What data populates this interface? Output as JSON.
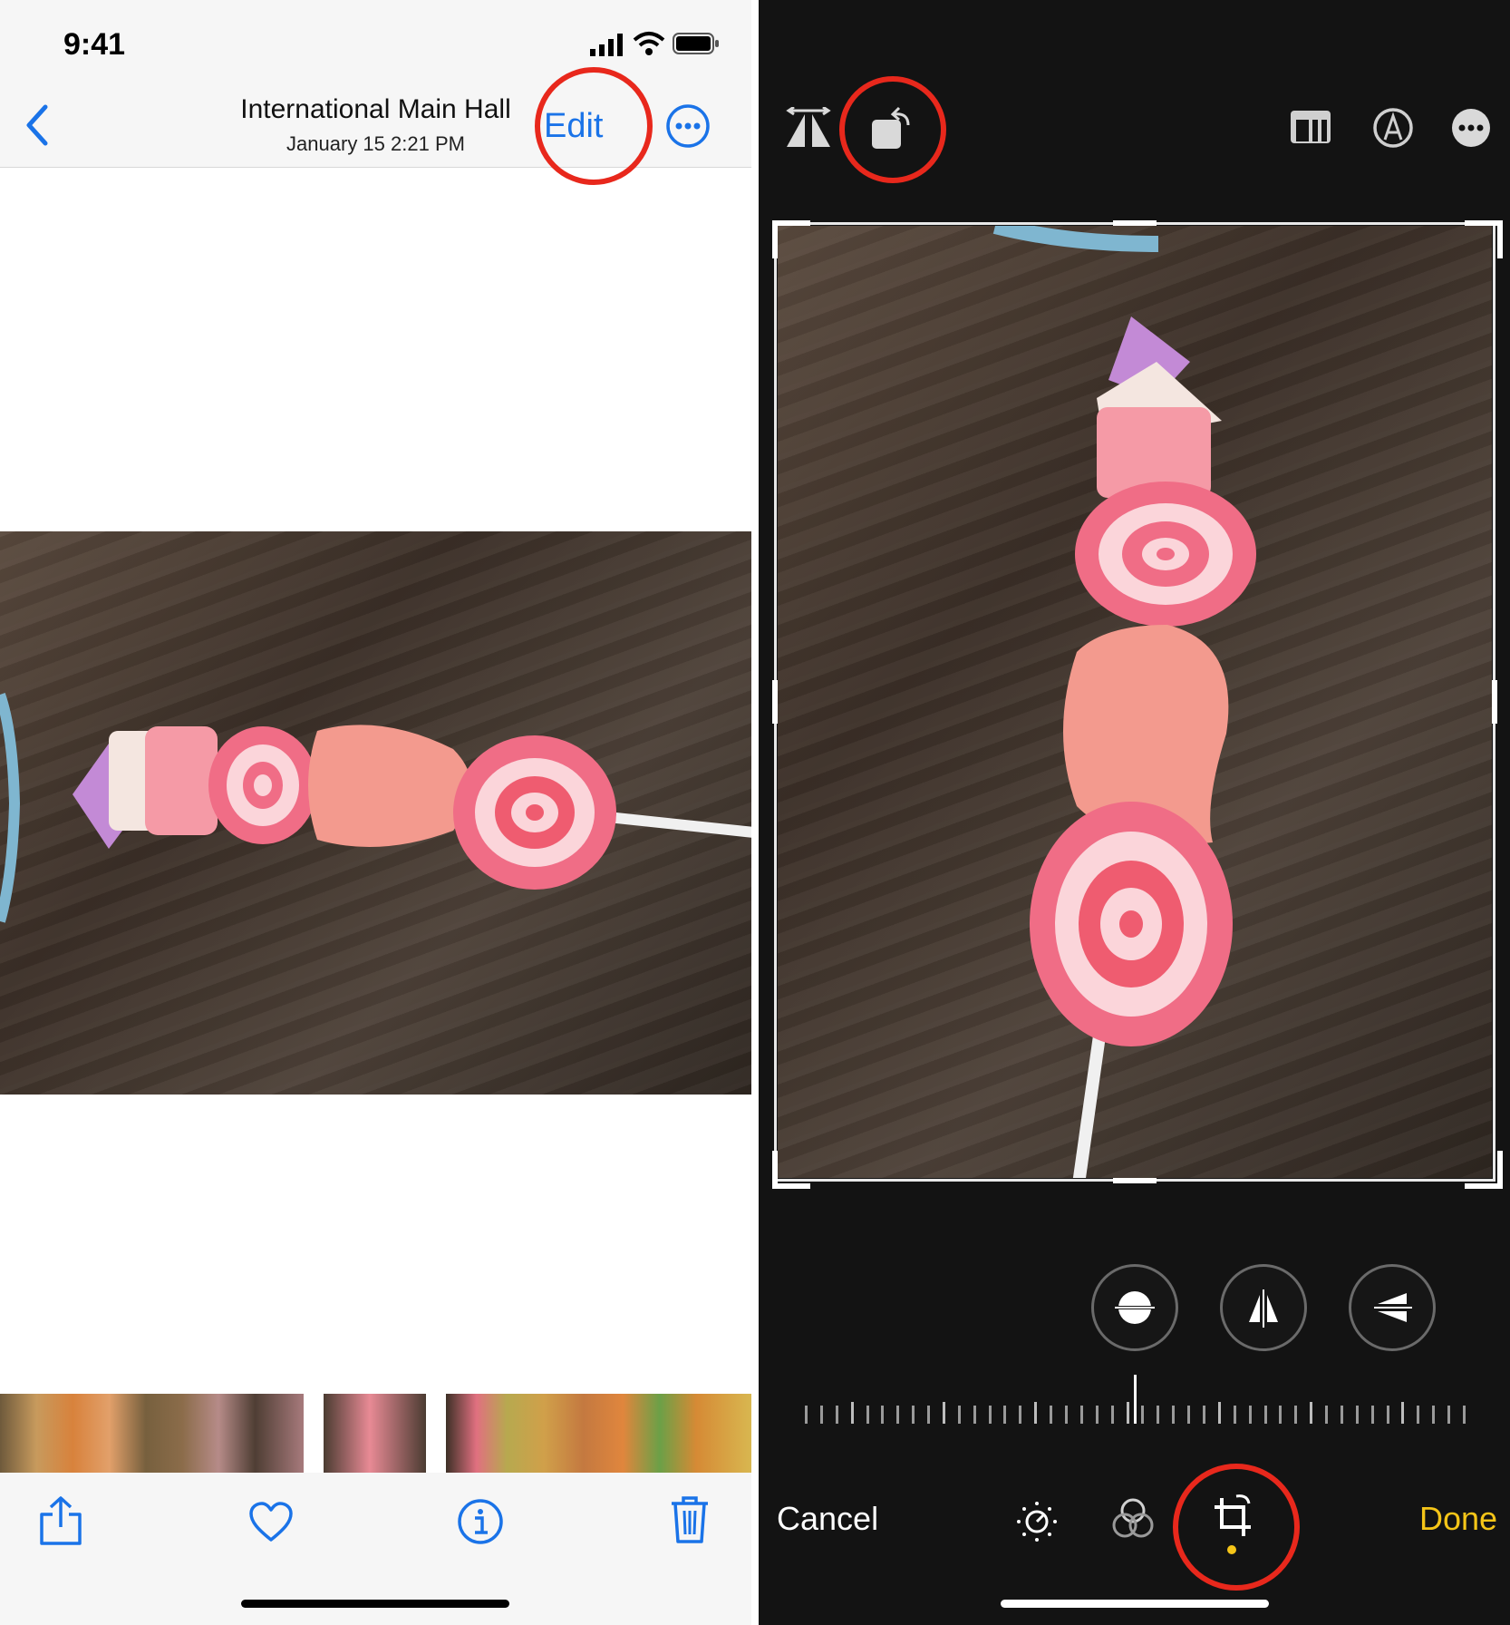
{
  "left": {
    "status_time": "9:41",
    "nav_title": "International Main Hall",
    "nav_subtitle": "January 15  2:21 PM",
    "edit_label": "Edit",
    "icons": {
      "back": "chevron-left-icon",
      "more": "ellipsis-circle-icon",
      "share": "share-icon",
      "favorite": "heart-icon",
      "info": "info-icon",
      "delete": "trash-icon"
    },
    "accent": "#1a73e8"
  },
  "right": {
    "cancel_label": "Cancel",
    "done_label": "Done",
    "top_tools": [
      "flip-icon",
      "rotate-icon",
      "aspect-ratio-icon",
      "markup-icon",
      "more-icon"
    ],
    "straighten_tools": [
      "straighten-icon",
      "vertical-perspective-icon",
      "horizontal-perspective-icon"
    ],
    "bottom_tools": [
      "adjust-icon",
      "filters-icon",
      "crop-icon"
    ],
    "done_color": "#f5c518"
  },
  "highlight_color": "#e8281c"
}
